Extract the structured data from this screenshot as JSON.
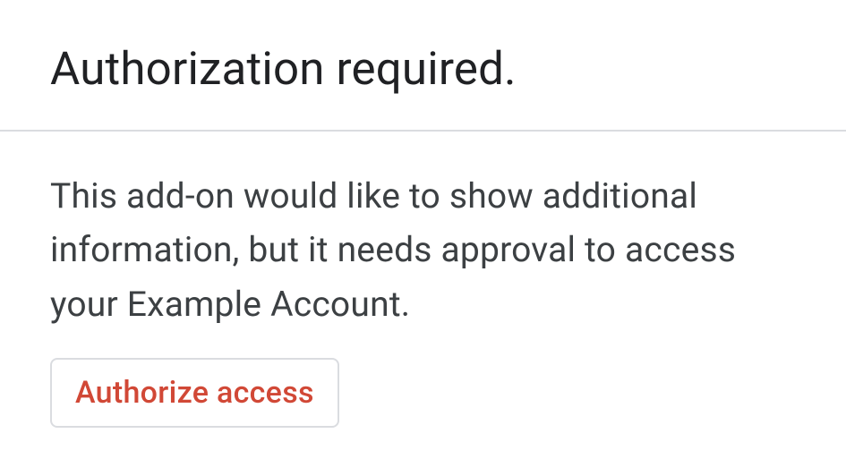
{
  "header": {
    "title": "Authorization required."
  },
  "content": {
    "description": "This add-on would like to show additional information, but it needs approval to access your Example Account.",
    "button_label": "Authorize access"
  }
}
